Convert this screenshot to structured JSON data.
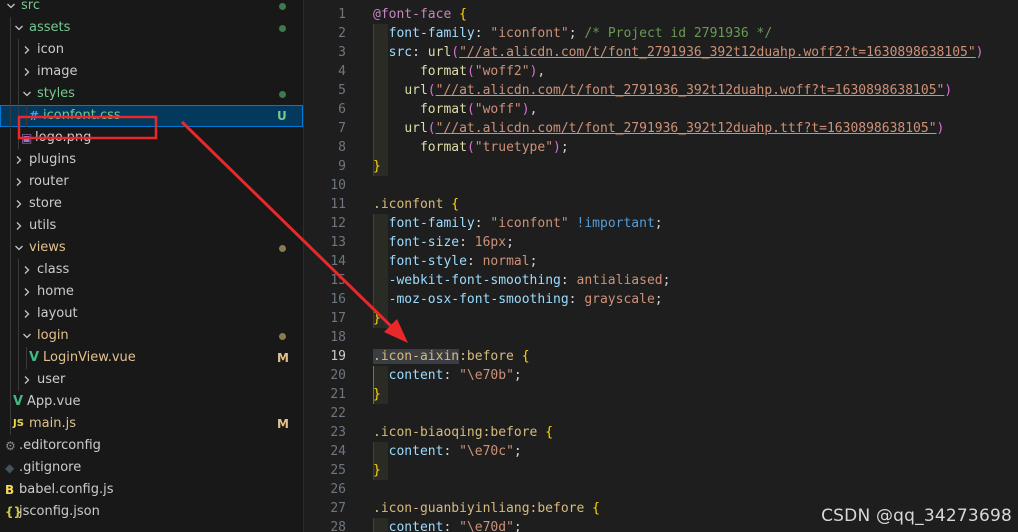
{
  "explorer": {
    "items": [
      {
        "label": "src",
        "type": "folder",
        "open": true,
        "depth": 0,
        "status": "dot",
        "status_color": "#3e7a4e"
      },
      {
        "label": "assets",
        "type": "folder",
        "open": true,
        "depth": 1,
        "status": "dot",
        "status_color": "#3e7a4e"
      },
      {
        "label": "icon",
        "type": "folder",
        "open": false,
        "depth": 2
      },
      {
        "label": "image",
        "type": "folder",
        "open": false,
        "depth": 2
      },
      {
        "label": "styles",
        "type": "folder",
        "open": true,
        "depth": 2,
        "status": "dot",
        "status_color": "#3e7a4e"
      },
      {
        "label": "iconfont.css",
        "type": "css",
        "depth": 3,
        "selected": true,
        "status": "U",
        "status_color": "#73c991"
      },
      {
        "label": "logo.png",
        "type": "image",
        "depth": 2
      },
      {
        "label": "plugins",
        "type": "folder",
        "open": false,
        "depth": 1
      },
      {
        "label": "router",
        "type": "folder",
        "open": false,
        "depth": 1
      },
      {
        "label": "store",
        "type": "folder",
        "open": false,
        "depth": 1
      },
      {
        "label": "utils",
        "type": "folder",
        "open": false,
        "depth": 1
      },
      {
        "label": "views",
        "type": "folder",
        "open": true,
        "depth": 1,
        "status": "dot",
        "status_color": "#8a7a50"
      },
      {
        "label": "class",
        "type": "folder",
        "open": false,
        "depth": 2
      },
      {
        "label": "home",
        "type": "folder",
        "open": false,
        "depth": 2
      },
      {
        "label": "layout",
        "type": "folder",
        "open": false,
        "depth": 2
      },
      {
        "label": "login",
        "type": "folder",
        "open": true,
        "depth": 2,
        "status": "dot",
        "status_color": "#8a7a50"
      },
      {
        "label": "LoginView.vue",
        "type": "vue",
        "depth": 3,
        "status": "M",
        "status_color": "#e2c08d"
      },
      {
        "label": "user",
        "type": "folder",
        "open": false,
        "depth": 2
      },
      {
        "label": "App.vue",
        "type": "vue",
        "depth": 1
      },
      {
        "label": "main.js",
        "type": "js",
        "depth": 1,
        "status": "M",
        "status_color": "#e2c08d"
      },
      {
        "label": ".editorconfig",
        "type": "config",
        "depth": 0
      },
      {
        "label": ".gitignore",
        "type": "git",
        "depth": 0
      },
      {
        "label": "babel.config.js",
        "type": "babel",
        "depth": 0
      },
      {
        "label": "jsconfig.json",
        "type": "json",
        "depth": 0
      }
    ]
  },
  "editor": {
    "active_line": 19,
    "lines": [
      {
        "n": "1",
        "tokens": [
          [
            "t-at",
            "@font-face"
          ],
          [
            "t-punc",
            " "
          ],
          [
            "t-brace",
            "{"
          ]
        ]
      },
      {
        "n": "2",
        "tokens": [
          [
            "t-punc",
            "  "
          ],
          [
            "t-prop",
            "font-family"
          ],
          [
            "t-punc",
            ": "
          ],
          [
            "t-str",
            "\"iconfont\""
          ],
          [
            "t-punc",
            "; "
          ],
          [
            "t-comment",
            "/* Project id 2791936 */"
          ]
        ]
      },
      {
        "n": "3",
        "tokens": [
          [
            "t-punc",
            "  "
          ],
          [
            "t-prop",
            "src"
          ],
          [
            "t-punc",
            ": "
          ],
          [
            "t-fn",
            "url"
          ],
          [
            "t-paren",
            "("
          ],
          [
            "t-url",
            "\"//at.alicdn.com/t/font_2791936_392t12duahp.woff2?t=1630898638105\""
          ],
          [
            "t-paren",
            ")"
          ]
        ]
      },
      {
        "n": "4",
        "tokens": [
          [
            "t-punc",
            "      "
          ],
          [
            "t-fn",
            "format"
          ],
          [
            "t-paren",
            "("
          ],
          [
            "t-str",
            "\"woff2\""
          ],
          [
            "t-paren",
            ")"
          ],
          [
            "t-punc",
            ","
          ]
        ]
      },
      {
        "n": "5",
        "tokens": [
          [
            "t-punc",
            "    "
          ],
          [
            "t-fn",
            "url"
          ],
          [
            "t-paren",
            "("
          ],
          [
            "t-url",
            "\"//at.alicdn.com/t/font_2791936_392t12duahp.woff?t=1630898638105\""
          ],
          [
            "t-paren",
            ")"
          ]
        ]
      },
      {
        "n": "6",
        "tokens": [
          [
            "t-punc",
            "      "
          ],
          [
            "t-fn",
            "format"
          ],
          [
            "t-paren",
            "("
          ],
          [
            "t-str",
            "\"woff\""
          ],
          [
            "t-paren",
            ")"
          ],
          [
            "t-punc",
            ","
          ]
        ]
      },
      {
        "n": "7",
        "tokens": [
          [
            "t-punc",
            "    "
          ],
          [
            "t-fn",
            "url"
          ],
          [
            "t-paren",
            "("
          ],
          [
            "t-url",
            "\"//at.alicdn.com/t/font_2791936_392t12duahp.ttf?t=1630898638105\""
          ],
          [
            "t-paren",
            ")"
          ]
        ]
      },
      {
        "n": "8",
        "tokens": [
          [
            "t-punc",
            "      "
          ],
          [
            "t-fn",
            "format"
          ],
          [
            "t-paren",
            "("
          ],
          [
            "t-str",
            "\"truetype\""
          ],
          [
            "t-paren",
            ")"
          ],
          [
            "t-punc",
            ";"
          ]
        ]
      },
      {
        "n": "9",
        "tokens": [
          [
            "t-brace",
            "}"
          ]
        ]
      },
      {
        "n": "10",
        "tokens": []
      },
      {
        "n": "11",
        "tokens": [
          [
            "t-sel",
            ".iconfont"
          ],
          [
            "t-punc",
            " "
          ],
          [
            "t-brace",
            "{"
          ]
        ]
      },
      {
        "n": "12",
        "tokens": [
          [
            "t-punc",
            "  "
          ],
          [
            "t-prop",
            "font-family"
          ],
          [
            "t-punc",
            ": "
          ],
          [
            "t-str",
            "\"iconfont\""
          ],
          [
            "t-punc",
            " "
          ],
          [
            "t-kw",
            "!important"
          ],
          [
            "t-punc",
            ";"
          ]
        ]
      },
      {
        "n": "13",
        "tokens": [
          [
            "t-punc",
            "  "
          ],
          [
            "t-prop",
            "font-size"
          ],
          [
            "t-punc",
            ": "
          ],
          [
            "t-str",
            "16px"
          ],
          [
            "t-punc",
            ";"
          ]
        ]
      },
      {
        "n": "14",
        "tokens": [
          [
            "t-punc",
            "  "
          ],
          [
            "t-prop",
            "font-style"
          ],
          [
            "t-punc",
            ": "
          ],
          [
            "t-str",
            "normal"
          ],
          [
            "t-punc",
            ";"
          ]
        ]
      },
      {
        "n": "15",
        "tokens": [
          [
            "t-punc",
            "  "
          ],
          [
            "t-prop",
            "-webkit-font-smoothing"
          ],
          [
            "t-punc",
            ": "
          ],
          [
            "t-str",
            "antialiased"
          ],
          [
            "t-punc",
            ";"
          ]
        ]
      },
      {
        "n": "16",
        "tokens": [
          [
            "t-punc",
            "  "
          ],
          [
            "t-prop",
            "-moz-osx-font-smoothing"
          ],
          [
            "t-punc",
            ": "
          ],
          [
            "t-str",
            "grayscale"
          ],
          [
            "t-punc",
            ";"
          ]
        ]
      },
      {
        "n": "17",
        "tokens": [
          [
            "t-brace",
            "}"
          ]
        ]
      },
      {
        "n": "18",
        "tokens": []
      },
      {
        "n": "19",
        "tokens": [
          [
            "t-sel",
            ".icon-aixin"
          ],
          [
            "t-sel",
            ":before"
          ],
          [
            "t-punc",
            " "
          ],
          [
            "t-brace",
            "{"
          ]
        ]
      },
      {
        "n": "20",
        "tokens": [
          [
            "t-punc",
            "  "
          ],
          [
            "t-prop",
            "content"
          ],
          [
            "t-punc",
            ": "
          ],
          [
            "t-str",
            "\"\\e70b\""
          ],
          [
            "t-punc",
            ";"
          ]
        ]
      },
      {
        "n": "21",
        "tokens": [
          [
            "t-brace",
            "}"
          ]
        ]
      },
      {
        "n": "22",
        "tokens": []
      },
      {
        "n": "23",
        "tokens": [
          [
            "t-sel",
            ".icon-biaoqing:before"
          ],
          [
            "t-punc",
            " "
          ],
          [
            "t-brace",
            "{"
          ]
        ]
      },
      {
        "n": "24",
        "tokens": [
          [
            "t-punc",
            "  "
          ],
          [
            "t-prop",
            "content"
          ],
          [
            "t-punc",
            ": "
          ],
          [
            "t-str",
            "\"\\e70c\""
          ],
          [
            "t-punc",
            ";"
          ]
        ]
      },
      {
        "n": "25",
        "tokens": [
          [
            "t-brace",
            "}"
          ]
        ]
      },
      {
        "n": "26",
        "tokens": []
      },
      {
        "n": "27",
        "tokens": [
          [
            "t-sel",
            ".icon-guanbiyinliang:before"
          ],
          [
            "t-punc",
            " "
          ],
          [
            "t-brace",
            "{"
          ]
        ]
      },
      {
        "n": "28",
        "tokens": [
          [
            "t-punc",
            "  "
          ],
          [
            "t-prop",
            "content"
          ],
          [
            "t-punc",
            ": "
          ],
          [
            "t-str",
            "\"\\e70d\""
          ],
          [
            "t-punc",
            ";"
          ]
        ]
      }
    ]
  },
  "watermark": "CSDN @qq_34273698",
  "colors": {
    "annotation": "#e8282b",
    "accent": "#0078d4"
  }
}
